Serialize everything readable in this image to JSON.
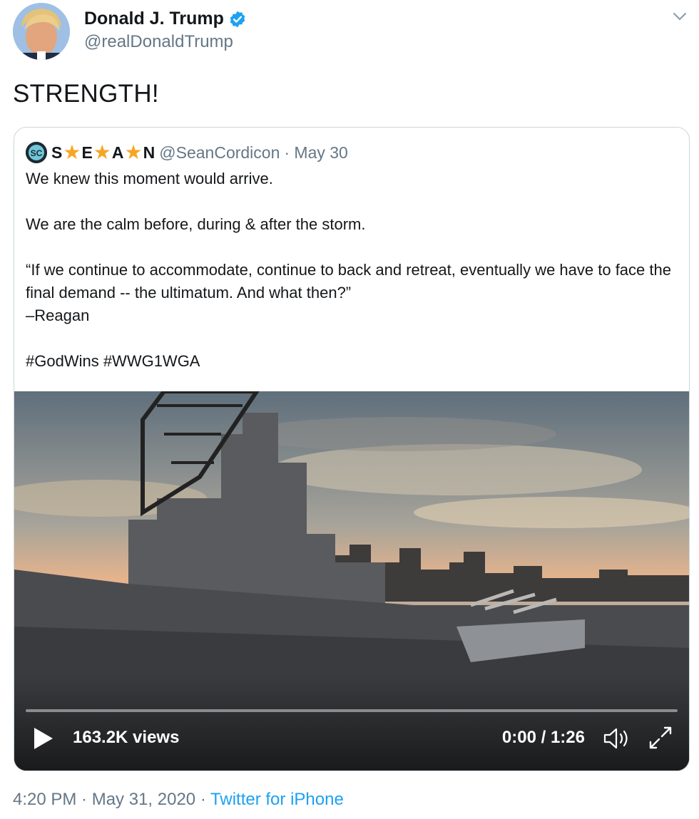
{
  "tweet": {
    "author": {
      "name": "Donald J. Trump",
      "handle": "@realDonaldTrump",
      "verified": true
    },
    "text": "STRENGTH!",
    "timestamp": "4:20 PM · May 31, 2020",
    "separator": "·",
    "source": "Twitter for iPhone"
  },
  "quoted_tweet": {
    "avatar_initials": "SC",
    "name_letters": [
      "S",
      "E",
      "A",
      "N"
    ],
    "name_decoration": "★",
    "handle": "@SeanCordicon",
    "date": "· May 30",
    "body": "We knew this moment would arrive.\n\nWe are the calm before, during & after the storm.\n\n“If we continue to accommodate, continue to back and retreat, eventually we have to face the final demand -- the ultimatum. And what then?”\n–Reagan\n\n#GodWins #WWG1WGA",
    "video": {
      "views": "163.2K views",
      "time": "0:00 / 1:26",
      "progress": 0
    }
  },
  "colors": {
    "accent": "#1da1f2",
    "verified": "#1da1f2",
    "star": "#f5a623",
    "secondary_text": "#657786",
    "border": "#ccd6dd"
  },
  "icons": {
    "verified": "verified-badge-icon",
    "caret": "chevron-down-icon",
    "play": "play-icon",
    "volume": "volume-icon",
    "fullscreen": "fullscreen-icon"
  }
}
